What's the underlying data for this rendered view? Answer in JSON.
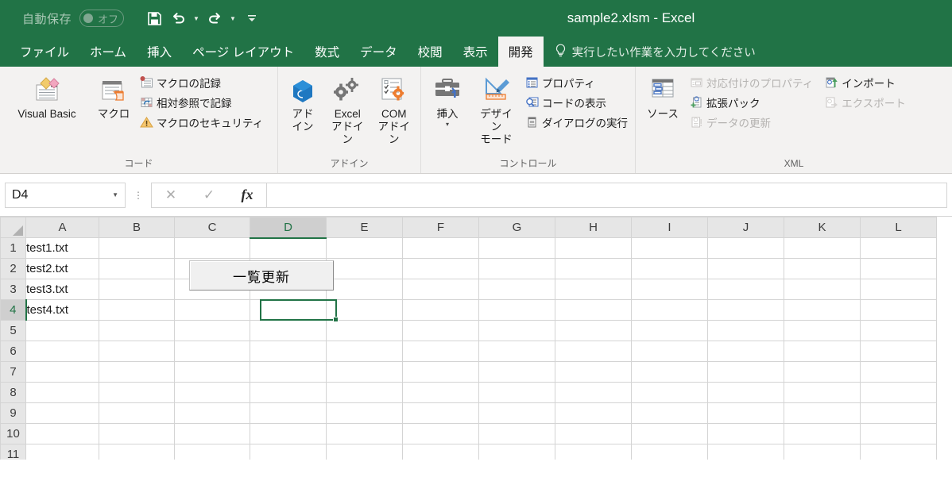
{
  "titlebar": {
    "autosave_label": "自動保存",
    "autosave_state": "オフ",
    "window_title": "sample2.xlsm  -  Excel",
    "qat": [
      {
        "name": "save-icon",
        "label": "保存"
      },
      {
        "name": "undo-icon",
        "label": "元に戻す"
      },
      {
        "name": "redo-icon",
        "label": "やり直し"
      },
      {
        "name": "customize-qat-icon",
        "label": "クイック アクセス ツール バーのユーザー設定"
      }
    ]
  },
  "tabs": [
    {
      "label": "ファイル",
      "active": false
    },
    {
      "label": "ホーム",
      "active": false
    },
    {
      "label": "挿入",
      "active": false
    },
    {
      "label": "ページ レイアウト",
      "active": false
    },
    {
      "label": "数式",
      "active": false
    },
    {
      "label": "データ",
      "active": false
    },
    {
      "label": "校閲",
      "active": false
    },
    {
      "label": "表示",
      "active": false
    },
    {
      "label": "開発",
      "active": true
    }
  ],
  "tellme": {
    "icon": "lightbulb-icon",
    "placeholder": "実行したい作業を入力してください"
  },
  "ribbon": {
    "groups": [
      {
        "name": "code",
        "label": "コード",
        "big": [
          {
            "line1": "Visual Basic",
            "line2": "",
            "icon": "visual-basic-icon"
          },
          {
            "line1": "マクロ",
            "line2": "",
            "icon": "macro-icon"
          }
        ],
        "small": [
          {
            "label": "マクロの記録",
            "icon": "record-macro-icon",
            "disabled": false
          },
          {
            "label": "相対参照で記録",
            "icon": "relative-reference-icon",
            "disabled": false
          },
          {
            "label": "マクロのセキュリティ",
            "icon": "macro-security-icon",
            "disabled": false
          }
        ]
      },
      {
        "name": "addins",
        "label": "アドイン",
        "big": [
          {
            "line1": "アド",
            "line2": "イン",
            "icon": "addins-icon"
          },
          {
            "line1": "Excel",
            "line2": "アドイン",
            "icon": "excel-addins-icon"
          },
          {
            "line1": "COM",
            "line2": "アドイン",
            "icon": "com-addins-icon"
          }
        ],
        "small": []
      },
      {
        "name": "controls",
        "label": "コントロール",
        "big": [
          {
            "line1": "挿入",
            "line2": "",
            "icon": "insert-control-icon",
            "caret": "▾"
          },
          {
            "line1": "デザイン",
            "line2": "モード",
            "icon": "design-mode-icon"
          }
        ],
        "small": [
          {
            "label": "プロパティ",
            "icon": "properties-icon",
            "disabled": false
          },
          {
            "label": "コードの表示",
            "icon": "view-code-icon",
            "disabled": false
          },
          {
            "label": "ダイアログの実行",
            "icon": "run-dialog-icon",
            "disabled": false
          }
        ]
      },
      {
        "name": "xml",
        "label": "XML",
        "big": [
          {
            "line1": "ソース",
            "line2": "",
            "icon": "xml-source-icon"
          }
        ],
        "small": [
          {
            "label": "対応付けのプロパティ",
            "icon": "map-properties-icon",
            "disabled": true
          },
          {
            "label": "拡張パック",
            "icon": "expansion-packs-icon",
            "disabled": false
          },
          {
            "label": "データの更新",
            "icon": "refresh-data-icon",
            "disabled": true
          }
        ],
        "small2": [
          {
            "label": "インポート",
            "icon": "import-icon",
            "disabled": false
          },
          {
            "label": "エクスポート",
            "icon": "export-icon",
            "disabled": true
          }
        ]
      }
    ]
  },
  "formula_bar": {
    "name_box_value": "D4",
    "cancel_label": "✕",
    "enter_label": "✓",
    "fx_label": "fx",
    "formula_value": ""
  },
  "sheet": {
    "columns": [
      "A",
      "B",
      "C",
      "D",
      "E",
      "F",
      "G",
      "H",
      "I",
      "J",
      "K",
      "L"
    ],
    "rows": [
      "1",
      "2",
      "3",
      "4",
      "5",
      "6",
      "7",
      "8",
      "9",
      "10",
      "11"
    ],
    "selected_cell": "D4",
    "selected_column": "D",
    "selected_row": "4",
    "cells": [
      {
        "row": "1",
        "col": "A",
        "value": "test1.txt"
      },
      {
        "row": "2",
        "col": "A",
        "value": "test2.txt"
      },
      {
        "row": "3",
        "col": "A",
        "value": "test3.txt"
      },
      {
        "row": "4",
        "col": "A",
        "value": "test4.txt"
      }
    ],
    "form_button": {
      "label": "一覧更新"
    }
  },
  "colors": {
    "brand_green": "#217346",
    "ribbon_bg": "#f3f2f1",
    "header_gray": "#e6e6e6",
    "gridline": "#d4d4d4"
  }
}
